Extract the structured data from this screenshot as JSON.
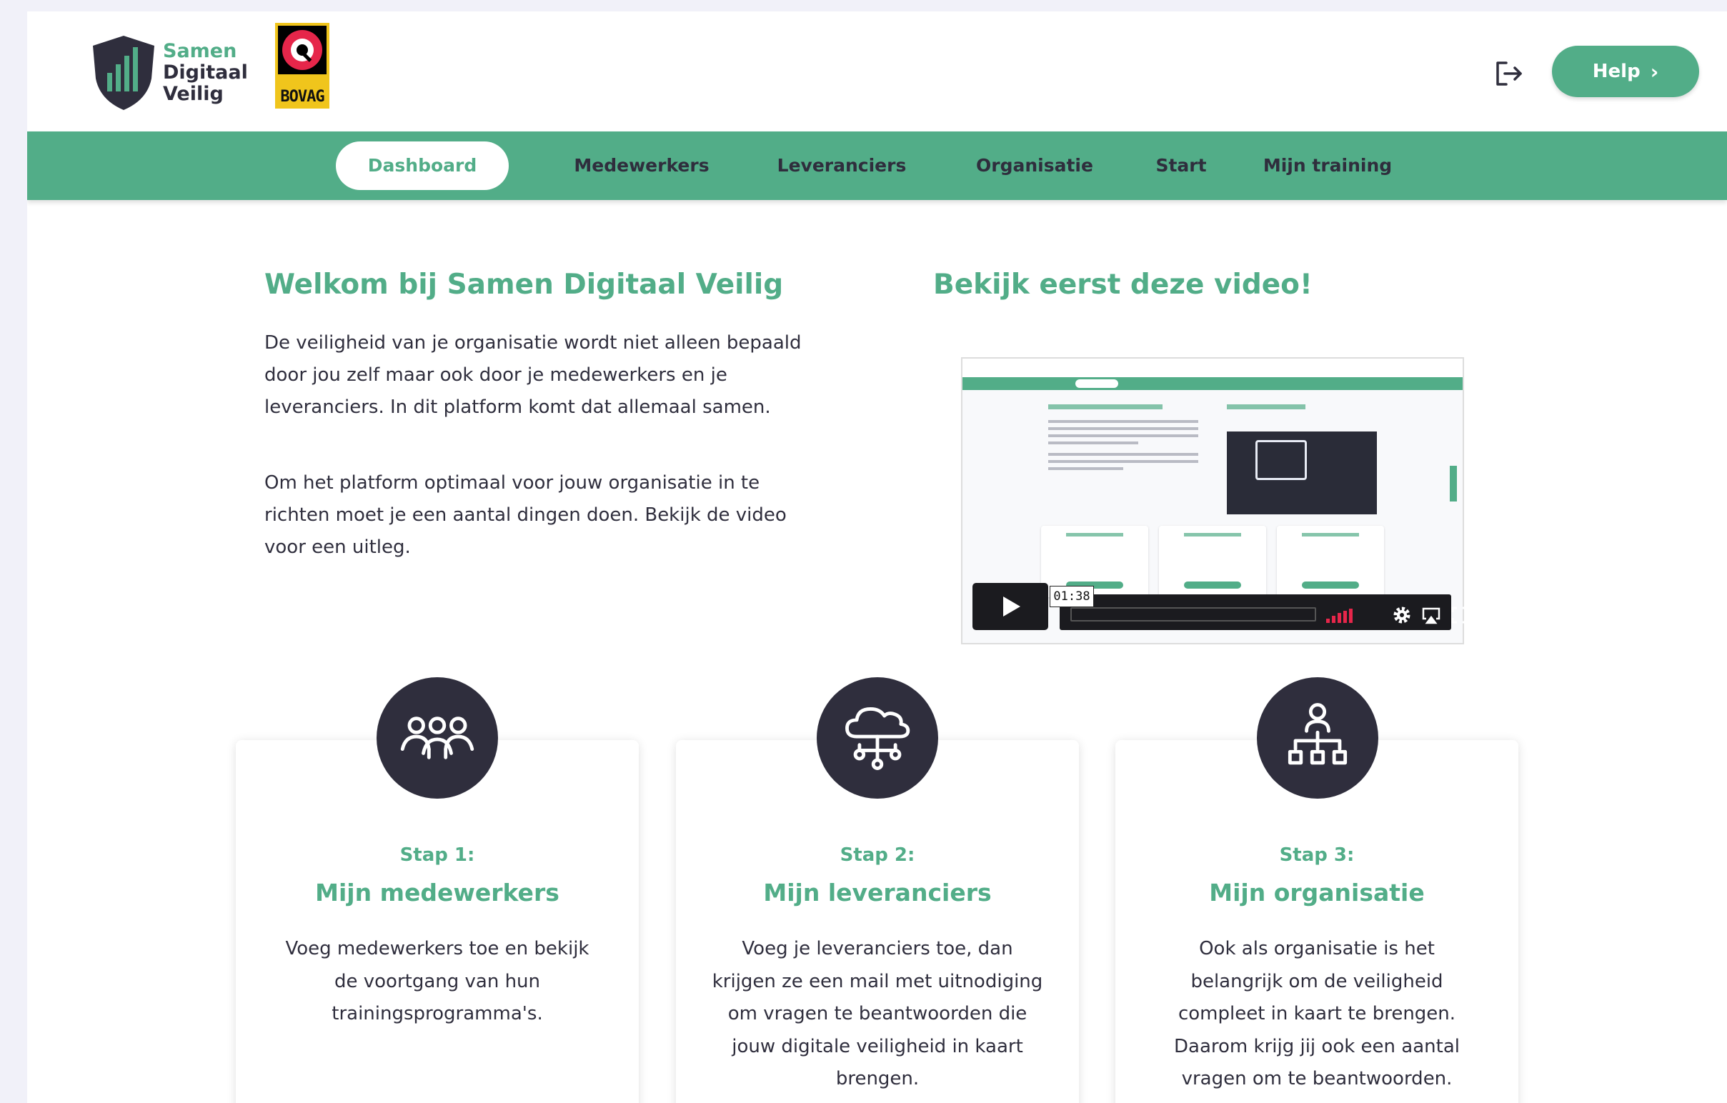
{
  "header": {
    "logo": {
      "line1": "Samen",
      "line2": "Digitaal",
      "line3": "Veilig"
    },
    "partner_logo": "BOVAG",
    "help_label": "Help",
    "icons": {
      "logout": "logout-icon",
      "help_chevron": "chevron-right-icon"
    }
  },
  "nav": {
    "items": [
      {
        "label": "Dashboard",
        "active": true
      },
      {
        "label": "Medewerkers",
        "active": false
      },
      {
        "label": "Leveranciers",
        "active": false
      },
      {
        "label": "Organisatie",
        "active": false
      },
      {
        "label": "Start",
        "active": false
      },
      {
        "label": "Mijn training",
        "active": false
      }
    ]
  },
  "intro": {
    "heading": "Welkom bij Samen Digitaal Veilig",
    "paragraph1": "De veiligheid van je organisatie wordt niet alleen bepaald door jou zelf maar ook door je medewerkers en je leveranciers. In dit platform komt dat allemaal samen.",
    "paragraph2": "Om het platform optimaal voor jouw organisatie in te richten moet je een aantal dingen doen. Bekijk de video voor een uitleg."
  },
  "video": {
    "heading": "Bekijk eerst deze video!",
    "duration": "01:38",
    "icons": [
      "play-icon",
      "volume-icon",
      "settings-icon",
      "airplay-icon",
      "fullscreen-icon"
    ]
  },
  "steps": [
    {
      "label": "Stap 1:",
      "title": "Mijn medewerkers",
      "text": "Voeg medewerkers toe en bekijk de voortgang van hun trainingsprogramma's.",
      "icon": "team-icon"
    },
    {
      "label": "Stap 2:",
      "title": "Mijn leveranciers",
      "text": "Voeg je leveranciers toe, dan krijgen ze een mail met uitnodiging om vragen te beantwoorden die jouw digitale veiligheid in kaart brengen.",
      "icon": "cloud-network-icon"
    },
    {
      "label": "Stap 3:",
      "title": "Mijn organisatie",
      "text": "Ook als organisatie is het belangrijk om de veiligheid compleet in kaart te brengen. Daarom krijg jij ook een aantal vragen om te beantwoorden.",
      "icon": "org-chart-icon"
    }
  ],
  "colors": {
    "brand_green": "#52ad88",
    "dark": "#2f2e3d",
    "accent_red": "#e6264a"
  }
}
